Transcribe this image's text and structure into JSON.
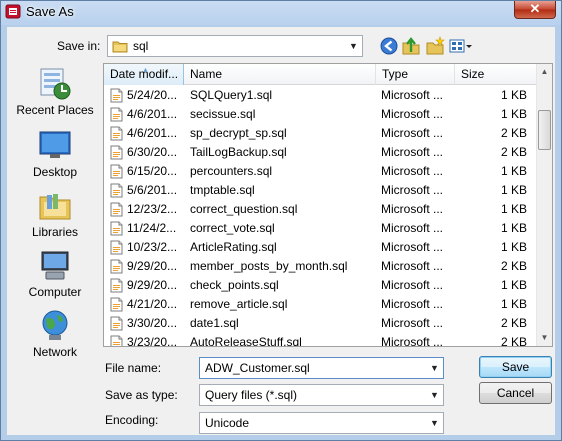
{
  "window": {
    "title": "Save As",
    "close_glyph": "✕"
  },
  "toolbar": {
    "save_in_label": "Save in:",
    "current_folder": "sql",
    "icons": [
      "back-icon",
      "up-folder-icon",
      "new-folder-icon",
      "views-menu-icon"
    ]
  },
  "places": [
    {
      "label": "Recent Places",
      "icon": "recent-places-icon"
    },
    {
      "label": "Desktop",
      "icon": "desktop-icon"
    },
    {
      "label": "Libraries",
      "icon": "libraries-icon"
    },
    {
      "label": "Computer",
      "icon": "computer-icon"
    },
    {
      "label": "Network",
      "icon": "network-icon"
    }
  ],
  "file_list": {
    "columns": [
      "Date modif...",
      "Name",
      "Type",
      "Size"
    ],
    "sorted_column": "Date modif...",
    "rows": [
      {
        "date": "5/24/20...",
        "name": "SQLQuery1.sql",
        "type": "Microsoft ...",
        "size": "1 KB"
      },
      {
        "date": "4/6/201...",
        "name": "secissue.sql",
        "type": "Microsoft ...",
        "size": "1 KB"
      },
      {
        "date": "4/6/201...",
        "name": "sp_decrypt_sp.sql",
        "type": "Microsoft ...",
        "size": "2 KB"
      },
      {
        "date": "6/30/20...",
        "name": "TailLogBackup.sql",
        "type": "Microsoft ...",
        "size": "2 KB"
      },
      {
        "date": "6/15/20...",
        "name": "percounters.sql",
        "type": "Microsoft ...",
        "size": "1 KB"
      },
      {
        "date": "5/6/201...",
        "name": "tmptable.sql",
        "type": "Microsoft ...",
        "size": "1 KB"
      },
      {
        "date": "12/23/2...",
        "name": "correct_question.sql",
        "type": "Microsoft ...",
        "size": "1 KB"
      },
      {
        "date": "11/24/2...",
        "name": "correct_vote.sql",
        "type": "Microsoft ...",
        "size": "1 KB"
      },
      {
        "date": "10/23/2...",
        "name": "ArticleRating.sql",
        "type": "Microsoft ...",
        "size": "1 KB"
      },
      {
        "date": "9/29/20...",
        "name": "member_posts_by_month.sql",
        "type": "Microsoft ...",
        "size": "2 KB"
      },
      {
        "date": "9/29/20...",
        "name": "check_points.sql",
        "type": "Microsoft ...",
        "size": "1 KB"
      },
      {
        "date": "4/21/20...",
        "name": "remove_article.sql",
        "type": "Microsoft ...",
        "size": "1 KB"
      },
      {
        "date": "3/30/20...",
        "name": "date1.sql",
        "type": "Microsoft ...",
        "size": "2 KB"
      },
      {
        "date": "3/23/20...",
        "name": "AutoReleaseStuff.sql",
        "type": "Microsoft ...",
        "size": "2 KB"
      }
    ]
  },
  "form": {
    "file_name_label": "File name:",
    "file_name_value": "ADW_Customer.sql",
    "save_as_type_label": "Save as type:",
    "save_as_type_value": "Query files (*.sql)",
    "encoding_label": "Encoding:",
    "encoding_value": "Unicode"
  },
  "buttons": {
    "save": "Save",
    "cancel": "Cancel"
  },
  "colors": {
    "title_bar": "#b9d1ee",
    "close_button": "#c4452f",
    "dialog_bg": "#f0f0f0",
    "default_button": "#bee6fd"
  }
}
